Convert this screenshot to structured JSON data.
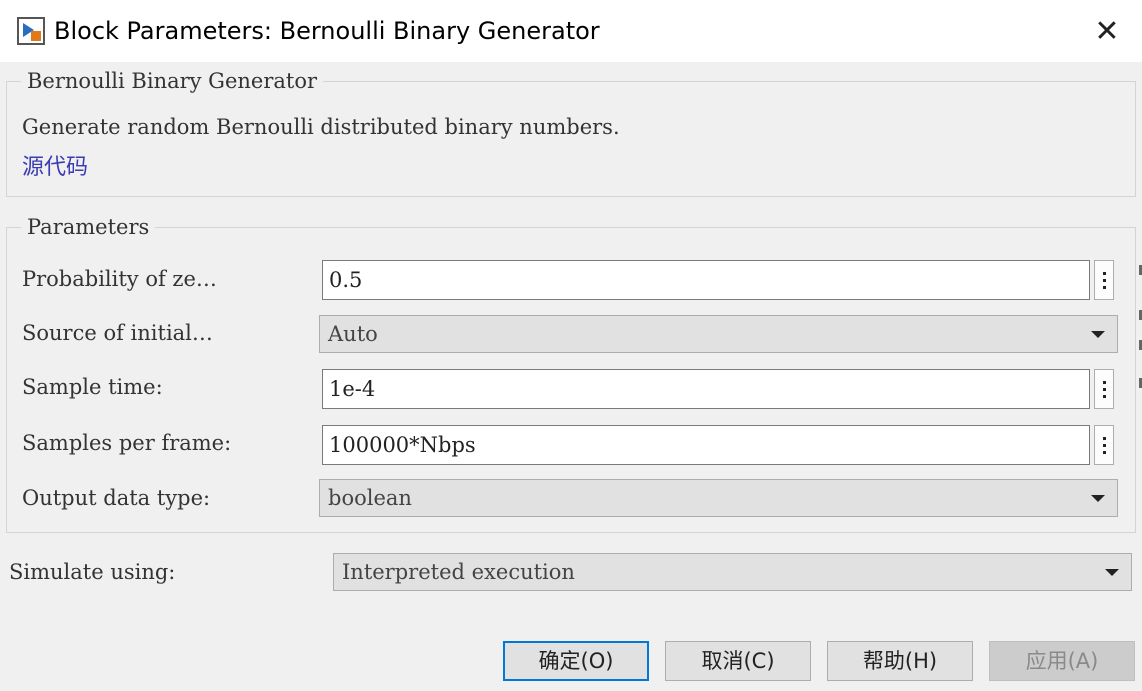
{
  "window": {
    "title": "Block Parameters: Bernoulli Binary Generator",
    "close_glyph": "✕"
  },
  "block_group": {
    "legend": "Bernoulli Binary Generator",
    "description": "Generate random Bernoulli distributed binary numbers.",
    "source_link": "源代码"
  },
  "parameters": {
    "legend": "Parameters",
    "rows": [
      {
        "label": "Probability of ze…",
        "value": "0.5",
        "kind": "text"
      },
      {
        "label": "Source of initial…",
        "value": "Auto",
        "kind": "dropdown"
      },
      {
        "label": "Sample time:",
        "value": "1e-4",
        "kind": "text"
      },
      {
        "label": "Samples per frame:",
        "value": "100000*Nbps",
        "kind": "text"
      },
      {
        "label": "Output data type:",
        "value": "boolean",
        "kind": "dropdown"
      }
    ]
  },
  "simulate": {
    "label": "Simulate using:",
    "value": "Interpreted execution"
  },
  "buttons": {
    "ok": "确定(O)",
    "cancel": "取消(C)",
    "help": "帮助(H)",
    "apply": "应用(A)"
  },
  "icons": {
    "app": "simulink-block-icon",
    "close": "close-icon",
    "more": "kebab-menu-icon",
    "dropdown": "chevron-down-icon"
  },
  "colors": {
    "link": "#3c3cb4",
    "primary_button_border": "#0078d7"
  }
}
